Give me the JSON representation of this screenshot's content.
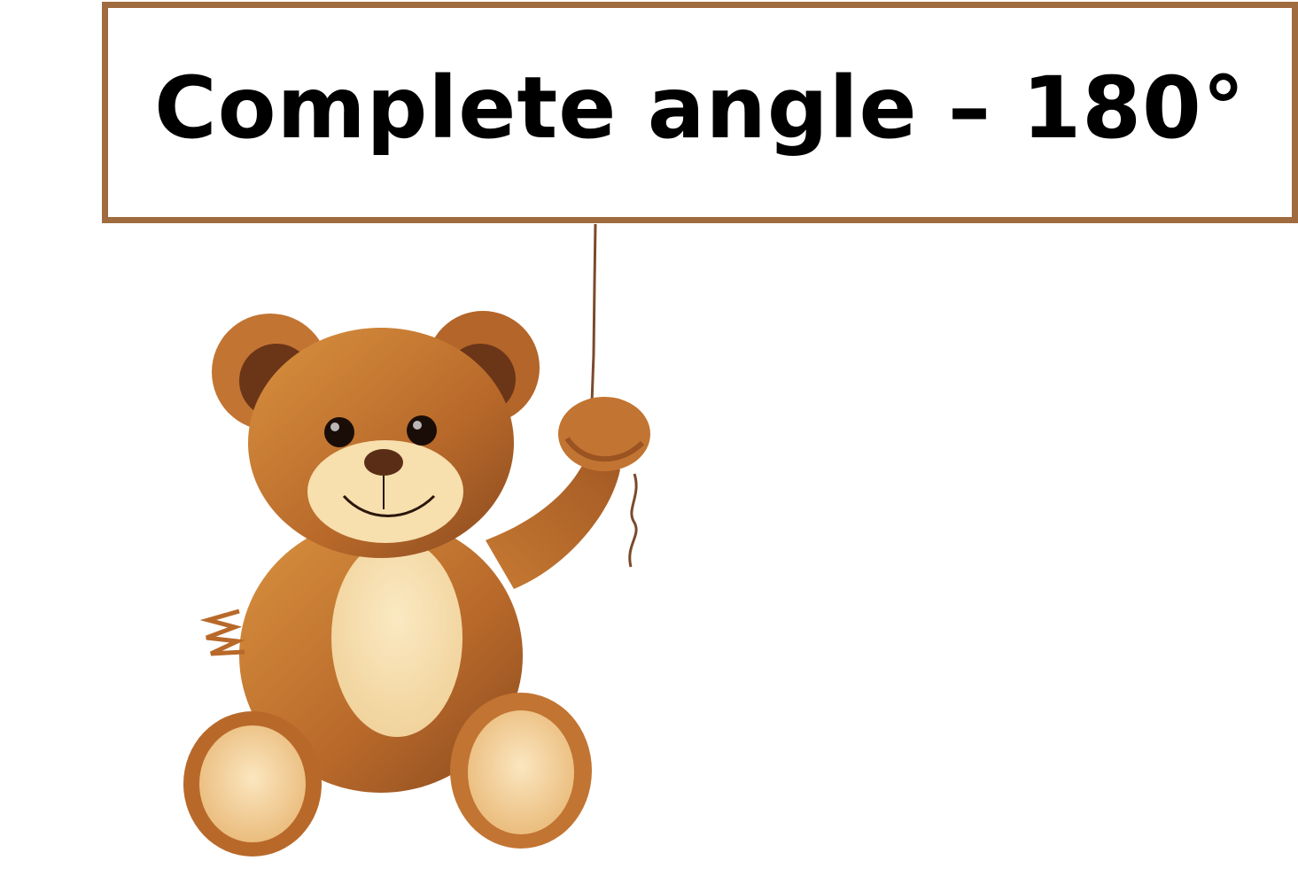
{
  "sign": {
    "text": "Complete angle – 180°"
  },
  "illustration": {
    "subject": "teddy-bear",
    "colors": {
      "frame": "#a06b3e",
      "fur": "#c97b35",
      "fur_dark": "#8a4f22",
      "belly": "#f7dfae",
      "string": "#7a4a2c"
    }
  }
}
